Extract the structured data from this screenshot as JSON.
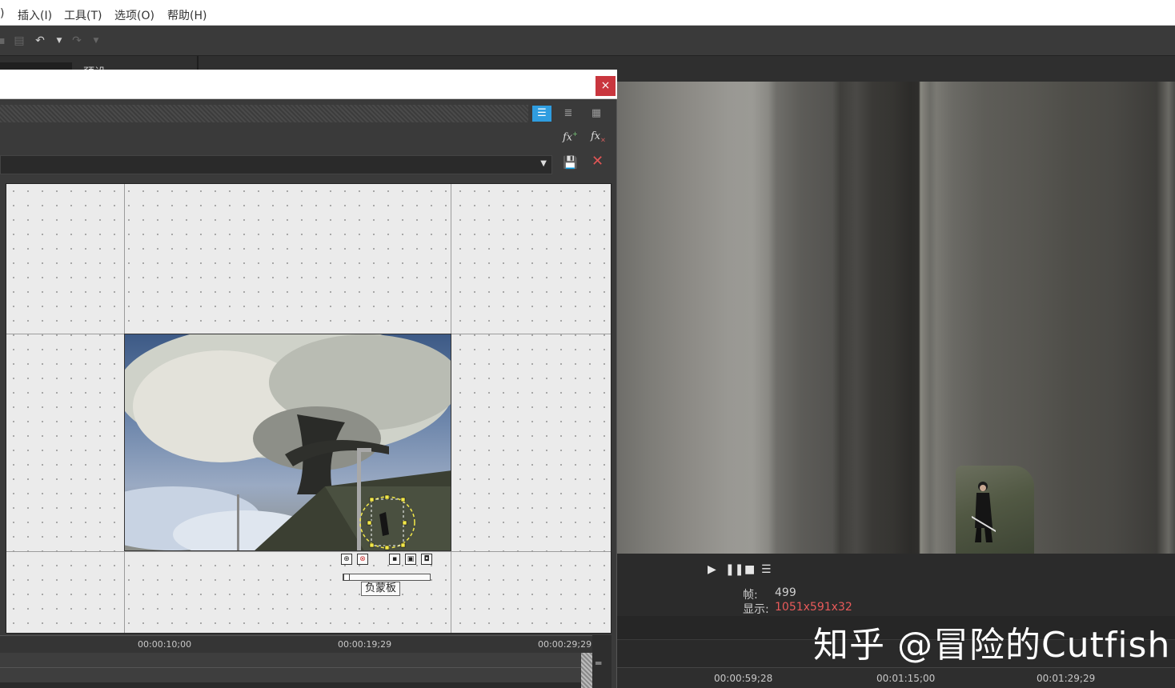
{
  "menu": {
    "items": [
      ")",
      "插入(I)",
      "工具(T)",
      "选项(O)",
      "帮助(H)"
    ]
  },
  "toolbar": {
    "icons": [
      "copy-icon",
      "paste-icon",
      "undo-icon",
      "undo-dropdown-icon",
      "redo-icon",
      "redo-dropdown-icon"
    ]
  },
  "strip": {
    "preset_label": "预设:"
  },
  "dialog": {
    "close_label": "×",
    "view_modes": [
      "list-view-icon",
      "details-view-icon",
      "grid-view-icon"
    ],
    "fx_add_label": "fx+",
    "fx_remove_label": "fx×",
    "preset_combo_value": "",
    "mask_label": "负蒙板",
    "ruler_ticks": [
      "00:00:10;00",
      "00:00:19;29",
      "00:00:29;29"
    ]
  },
  "preview": {
    "frame_label": "帧:",
    "frame_value": "499",
    "display_label": "显示:",
    "display_value": "1051x591x32",
    "ruler_ticks": [
      "00:00:59;28",
      "00:01:15;00",
      "00:01:29;29"
    ]
  },
  "watermark": "知乎 @冒险的Cutfish",
  "colors": {
    "accent": "#2f9de0",
    "close": "#c9363e",
    "display_value": "#e85a5a"
  }
}
